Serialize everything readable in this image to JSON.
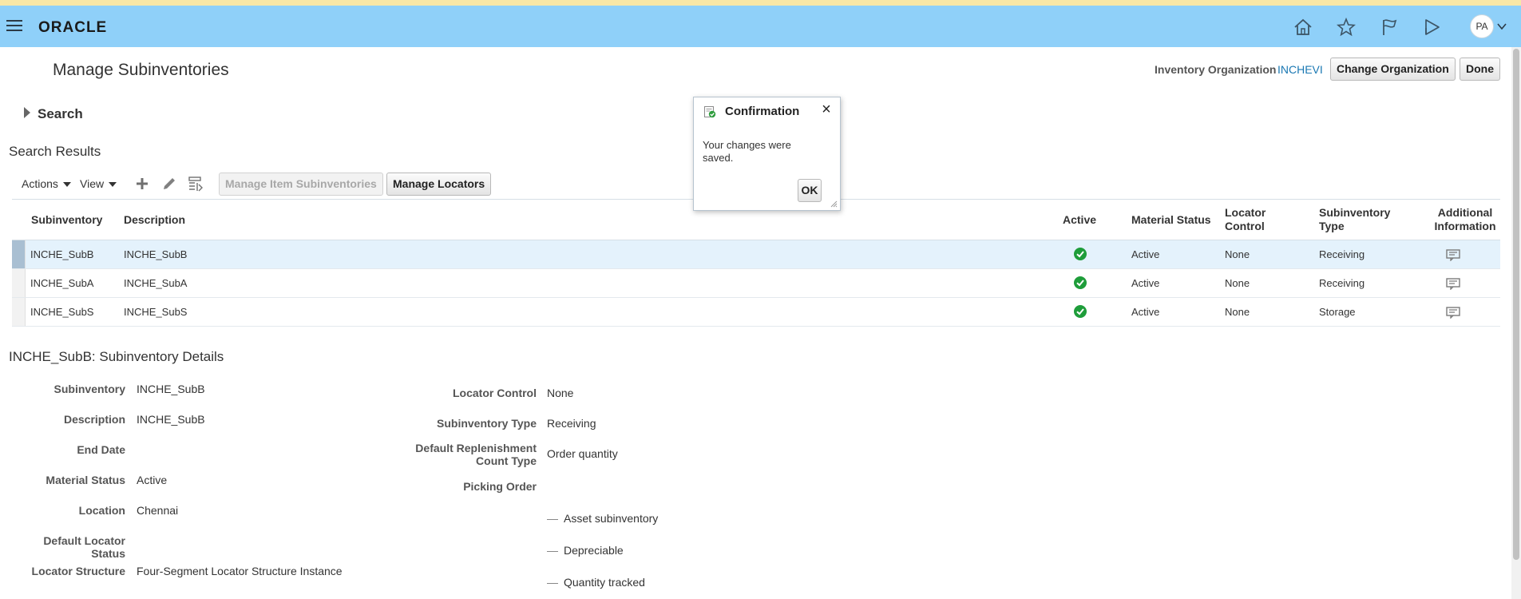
{
  "header": {
    "logo": "ORACLE",
    "avatar_initials": "PA",
    "icons": [
      "home-icon",
      "star-icon",
      "flag-icon",
      "notification-icon"
    ],
    "bar_color": "#8fd0f9"
  },
  "page": {
    "title": "Manage Subinventories",
    "inventory_org_label": "Inventory Organization",
    "inventory_org_value": "INCHEVI",
    "change_org_button": "Change Organization",
    "done_button": "Done",
    "search_label": "Search",
    "results_title": "Search Results"
  },
  "toolbar": {
    "actions_label": "Actions",
    "view_label": "View",
    "manage_item_subinventories": "Manage Item Subinventories",
    "manage_locators": "Manage Locators"
  },
  "table": {
    "columns": {
      "subinventory": "Subinventory",
      "description": "Description",
      "active": "Active",
      "material_status": "Material Status",
      "locator_control_1": "Locator",
      "locator_control_2": "Control",
      "subinventory_type_1": "Subinventory",
      "subinventory_type_2": "Type",
      "additional_info_1": "Additional",
      "additional_info_2": "Information"
    },
    "rows": [
      {
        "subinventory": "INCHE_SubB",
        "description": "INCHE_SubB",
        "active": true,
        "material_status": "Active",
        "locator_control": "None",
        "type": "Receiving"
      },
      {
        "subinventory": "INCHE_SubA",
        "description": "INCHE_SubA",
        "active": true,
        "material_status": "Active",
        "locator_control": "None",
        "type": "Receiving"
      },
      {
        "subinventory": "INCHE_SubS",
        "description": "INCHE_SubS",
        "active": true,
        "material_status": "Active",
        "locator_control": "None",
        "type": "Storage"
      }
    ]
  },
  "details": {
    "title": "INCHE_SubB: Subinventory Details",
    "left": {
      "subinventory_label": "Subinventory",
      "subinventory_value": "INCHE_SubB",
      "description_label": "Description",
      "description_value": "INCHE_SubB",
      "end_date_label": "End Date",
      "material_status_label": "Material Status",
      "material_status_value": "Active",
      "location_label": "Location",
      "location_value": "Chennai",
      "default_locator_status_label": "Default Locator Status",
      "locator_structure_label": "Locator Structure",
      "locator_structure_value": "Four-Segment Locator Structure Instance"
    },
    "right": {
      "locator_control_label": "Locator Control",
      "locator_control_value": "None",
      "subinventory_type_label": "Subinventory Type",
      "subinventory_type_value": "Receiving",
      "replenishment_label_1": "Default Replenishment",
      "replenishment_label_2": "Count Type",
      "replenishment_value": "Order quantity",
      "picking_order_label": "Picking Order",
      "asset_subinventory": "Asset subinventory",
      "depreciable": "Depreciable",
      "quantity_tracked": "Quantity tracked"
    }
  },
  "dialog": {
    "title": "Confirmation",
    "message": "Your changes were saved.",
    "ok_button": "OK"
  },
  "colors": {
    "link": "#1a78b3",
    "selected_row": "#e4f2fc",
    "active_check": "#1e9d3a"
  }
}
